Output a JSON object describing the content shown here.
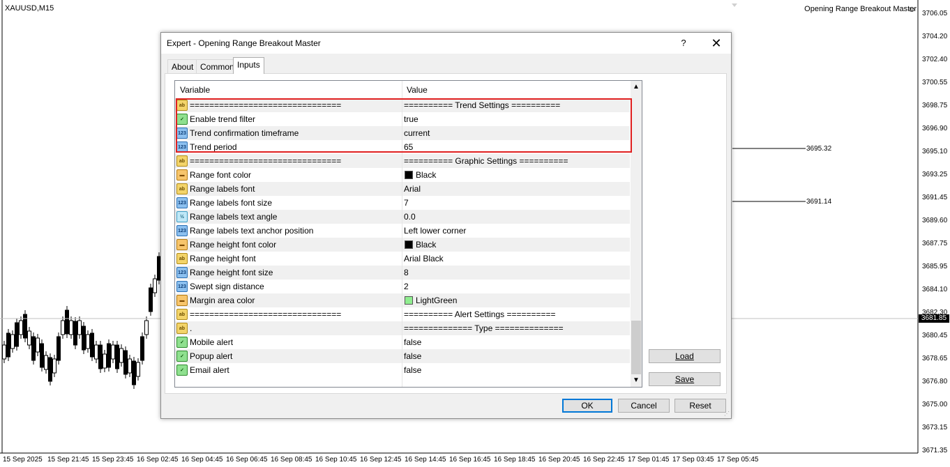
{
  "chart": {
    "symbol": "XAUUSD,M15",
    "ea_name": "Opening Range Breakout Master",
    "price_ticks": [
      "3706.05",
      "3704.20",
      "3702.40",
      "3700.55",
      "3698.75",
      "3696.90",
      "3695.10",
      "3693.25",
      "3691.45",
      "3689.60",
      "3687.75",
      "3685.95",
      "3684.10",
      "3682.30",
      "3680.45",
      "3678.65",
      "3676.80",
      "3675.00",
      "3673.15",
      "3671.35"
    ],
    "current_price": "3681.85",
    "levels": [
      "3695.32",
      "3691.14"
    ],
    "time_ticks": [
      "15 Sep 2025",
      "15 Sep 21:45",
      "15 Sep 23:45",
      "16 Sep 02:45",
      "16 Sep 04:45",
      "16 Sep 06:45",
      "16 Sep 08:45",
      "16 Sep 10:45",
      "16 Sep 12:45",
      "16 Sep 14:45",
      "16 Sep 16:45",
      "16 Sep 18:45",
      "16 Sep 20:45",
      "16 Sep 22:45",
      "17 Sep 01:45",
      "17 Sep 03:45",
      "17 Sep 05:45"
    ]
  },
  "dialog": {
    "title": "Expert - Opening Range Breakout Master",
    "help": "?",
    "close": "✕",
    "tabs": [
      "About",
      "Common",
      "Inputs"
    ],
    "columns": {
      "variable": "Variable",
      "value": "Value"
    },
    "rows": [
      {
        "icon": "ab-icon",
        "var": "===============================",
        "val": "========== Trend Settings =========="
      },
      {
        "icon": "bool-icon",
        "var": "Enable trend filter",
        "val": "true"
      },
      {
        "icon": "num-icon",
        "var": "Trend confirmation timeframe",
        "val": "current"
      },
      {
        "icon": "num-icon",
        "var": "Trend period",
        "val": "65"
      },
      {
        "icon": "ab-icon",
        "var": "===============================",
        "val": "========== Graphic Settings =========="
      },
      {
        "icon": "color-icon",
        "var": "Range font color",
        "val": "Black",
        "swatch": "#000000"
      },
      {
        "icon": "ab-icon",
        "var": "Range labels font",
        "val": "Arial"
      },
      {
        "icon": "num-icon",
        "var": "Range labels font size",
        "val": "7"
      },
      {
        "icon": "frac-icon",
        "var": "Range labels text angle",
        "val": "0.0"
      },
      {
        "icon": "num-icon",
        "var": "Range labels text anchor position",
        "val": "Left lower corner"
      },
      {
        "icon": "color-icon",
        "var": "Range height font color",
        "val": "Black",
        "swatch": "#000000"
      },
      {
        "icon": "ab-icon",
        "var": "Range height font",
        "val": "Arial Black"
      },
      {
        "icon": "num-icon",
        "var": "Range height font size",
        "val": "8"
      },
      {
        "icon": "num-icon",
        "var": "Swept sign distance",
        "val": "2"
      },
      {
        "icon": "color-icon",
        "var": "Margin area color",
        "val": "LightGreen",
        "swatch": "#90ee90"
      },
      {
        "icon": "ab-icon",
        "var": "===============================",
        "val": "========== Alert Settings =========="
      },
      {
        "icon": "ab-icon",
        "var": ".",
        "val": "============== Type =============="
      },
      {
        "icon": "bool-icon",
        "var": "Mobile alert",
        "val": "false"
      },
      {
        "icon": "bool-icon",
        "var": "Popup alert",
        "val": "false"
      },
      {
        "icon": "bool-icon",
        "var": "Email alert",
        "val": "false"
      }
    ],
    "buttons": {
      "load": "Load",
      "save": "Save",
      "ok": "OK",
      "cancel": "Cancel",
      "reset": "Reset"
    }
  }
}
